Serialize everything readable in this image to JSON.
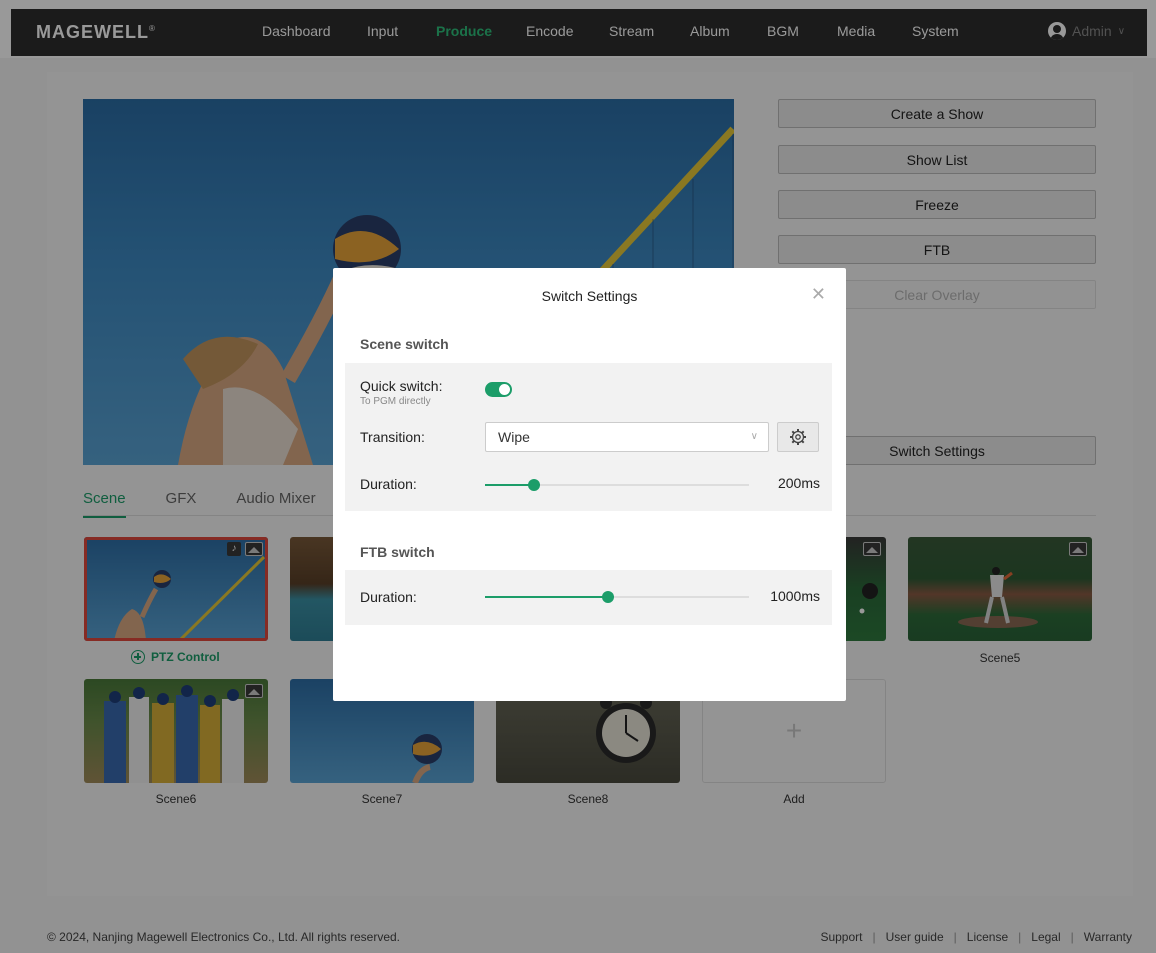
{
  "brand": "MAGEWELL",
  "nav": {
    "items": [
      "Dashboard",
      "Input",
      "Produce",
      "Encode",
      "Stream",
      "Album",
      "BGM",
      "Media",
      "System"
    ],
    "active": "Produce",
    "user": "Admin"
  },
  "side_buttons": {
    "create_show": "Create a Show",
    "show_list": "Show List",
    "freeze": "Freeze",
    "ftb": "FTB",
    "clear_overlay": "Clear Overlay",
    "switch_settings": "Switch Settings"
  },
  "tabs": [
    "Scene",
    "GFX",
    "Audio Mixer"
  ],
  "active_tab": "Scene",
  "ptz_label": "PTZ Control",
  "scenes": {
    "scene5": "Scene5",
    "scene6": "Scene6",
    "scene7": "Scene7",
    "scene8": "Scene8",
    "add": "Add"
  },
  "modal": {
    "title": "Switch Settings",
    "scene_switch": {
      "heading": "Scene switch",
      "quick_switch_label": "Quick switch:",
      "quick_switch_sub": "To PGM directly",
      "quick_switch_on": true,
      "transition_label": "Transition:",
      "transition_value": "Wipe",
      "duration_label": "Duration:",
      "duration_value": "200ms",
      "duration_fraction": 0.185
    },
    "ftb_switch": {
      "heading": "FTB switch",
      "duration_label": "Duration:",
      "duration_value": "1000ms",
      "duration_fraction": 0.465
    }
  },
  "footer": {
    "copyright": "© 2024, Nanjing Magewell Electronics Co., Ltd. All rights reserved.",
    "links": [
      "Support",
      "User guide",
      "License",
      "Legal",
      "Warranty"
    ]
  },
  "colors": {
    "accent": "#1c9d69",
    "nav_active": "#2ebf7b",
    "selected_border": "#e0483c",
    "topbar": "#2e2e2e"
  }
}
